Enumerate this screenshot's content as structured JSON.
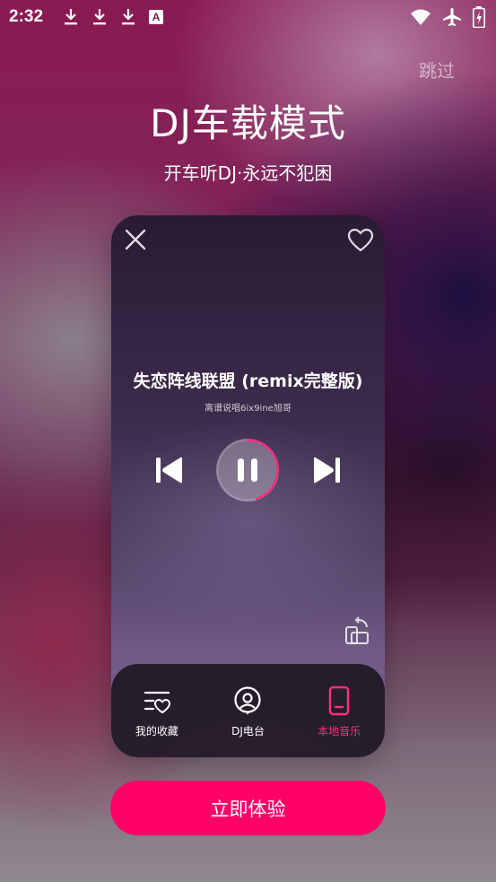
{
  "status_bar": {
    "time": "2:32",
    "a_badge": "A",
    "icons": [
      "download-icon",
      "download-icon",
      "download-icon",
      "a-notification-icon",
      "wifi-icon",
      "airplane-icon",
      "battery-charging-icon"
    ]
  },
  "skip_label": "跳过",
  "hero": {
    "title": "DJ车载模式",
    "subtitle": "开车听DJ·永远不犯困"
  },
  "player": {
    "song_title": "失恋阵线联盟 (remix完整版)",
    "artist": "离谱说唱6ix9ine旭哥",
    "state": "playing",
    "progress_fraction": 0.45
  },
  "tabs": [
    {
      "label": "我的收藏",
      "icon": "favorites-list-icon",
      "active": false
    },
    {
      "label": "DJ电台",
      "icon": "radio-icon",
      "active": false
    },
    {
      "label": "本地音乐",
      "icon": "phone-music-icon",
      "active": true
    }
  ],
  "cta_label": "立即体验",
  "colors": {
    "accent": "#ff0066",
    "active_tab": "#ff2d7a"
  }
}
